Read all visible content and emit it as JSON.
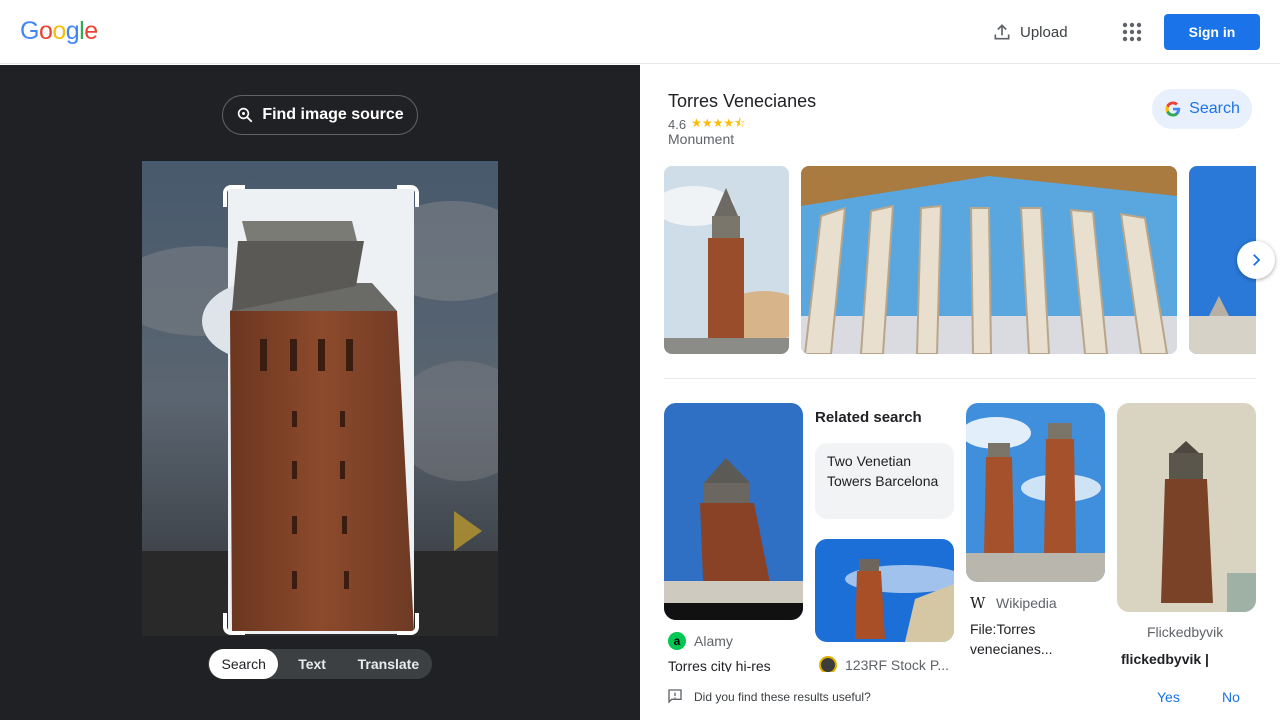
{
  "header": {
    "logo_letters": [
      {
        "ch": "G",
        "color": "#4285F4"
      },
      {
        "ch": "o",
        "color": "#EA4335"
      },
      {
        "ch": "o",
        "color": "#FBBC05"
      },
      {
        "ch": "g",
        "color": "#4285F4"
      },
      {
        "ch": "l",
        "color": "#34A853"
      },
      {
        "ch": "e",
        "color": "#EA4335"
      }
    ],
    "upload_label": "Upload",
    "apps_icon": "apps-grid-icon",
    "signin_label": "Sign in"
  },
  "lens": {
    "find_source_label": "Find image source",
    "tabs": [
      {
        "label": "Search",
        "active": true
      },
      {
        "label": "Text",
        "active": false
      },
      {
        "label": "Translate",
        "active": false
      }
    ]
  },
  "knowledge_panel": {
    "title": "Torres Venecianes",
    "rating": "4.6",
    "stars": "★★★★⯪",
    "type": "Monument",
    "search_button_label": "Search"
  },
  "results": {
    "related_heading": "Related search",
    "related_chip": "Two Venetian Towers Barcelona",
    "cards": [
      {
        "source": "Alamy",
        "title": "Torres city hi-res"
      },
      {
        "source": "123RF Stock P...",
        "title": ""
      },
      {
        "source": "Wikipedia",
        "title": "File:Torres venecianes..."
      },
      {
        "source": "Flickedbyvik",
        "title": "flickedbyvik |"
      }
    ]
  },
  "feedback": {
    "question": "Did you find these results useful?",
    "yes_label": "Yes",
    "no_label": "No"
  },
  "colors": {
    "accent": "#1a73e8",
    "dark_panel": "#202124",
    "brick": "#8a4a2c"
  }
}
